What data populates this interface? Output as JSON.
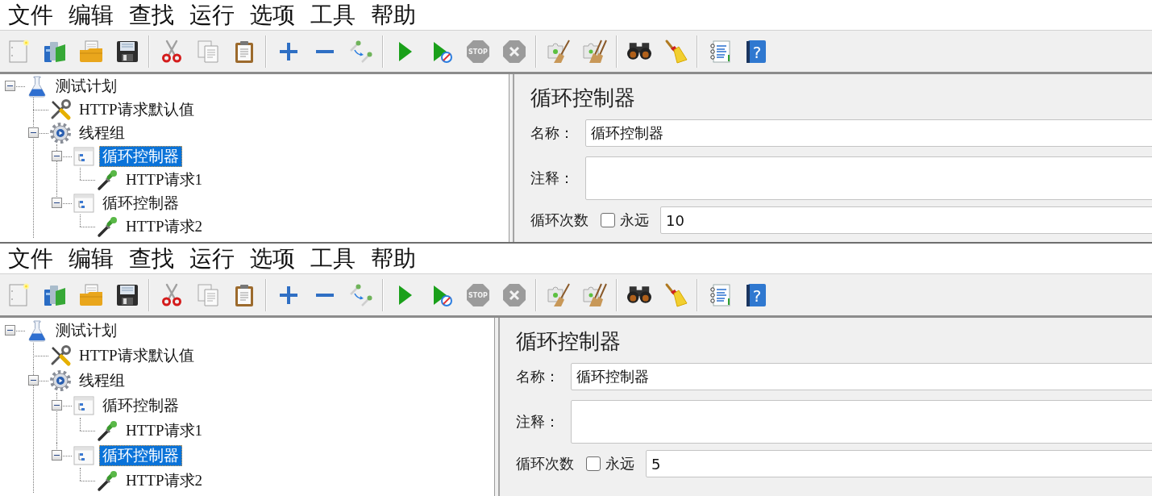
{
  "screenshots": [
    {
      "menu": [
        "文件",
        "编辑",
        "查找",
        "运行",
        "选项",
        "工具",
        "帮助"
      ],
      "toolbar": {
        "groups": [
          [
            {
              "kind": "new",
              "disabled": false
            },
            {
              "kind": "templates",
              "disabled": false
            },
            {
              "kind": "open",
              "disabled": false
            },
            {
              "kind": "save",
              "disabled": false
            }
          ],
          [
            {
              "kind": "cut",
              "disabled": false
            },
            {
              "kind": "copy",
              "disabled": false
            },
            {
              "kind": "paste",
              "disabled": false
            }
          ],
          [
            {
              "kind": "expand",
              "disabled": false
            },
            {
              "kind": "collapse",
              "disabled": false
            },
            {
              "kind": "toggle",
              "disabled": false
            }
          ],
          [
            {
              "kind": "start",
              "disabled": false
            },
            {
              "kind": "startnotimers",
              "disabled": false
            },
            {
              "kind": "stop",
              "text": "STOP",
              "disabled": true
            },
            {
              "kind": "shutdown",
              "disabled": true
            }
          ],
          [
            {
              "kind": "clear",
              "disabled": false
            },
            {
              "kind": "clearall",
              "disabled": false
            }
          ],
          [
            {
              "kind": "search",
              "disabled": false
            },
            {
              "kind": "reset",
              "disabled": false
            }
          ],
          [
            {
              "kind": "functions",
              "disabled": false
            },
            {
              "kind": "help",
              "text": "?",
              "disabled": false
            }
          ]
        ]
      },
      "tree": [
        {
          "label": "测试计划",
          "kind": "plan",
          "expanded": true,
          "selected": false,
          "children": [
            {
              "label": "HTTP请求默认值",
              "kind": "config",
              "selected": false
            },
            {
              "label": "线程组",
              "kind": "threadgroup",
              "expanded": true,
              "selected": false,
              "children": [
                {
                  "label": "循环控制器",
                  "kind": "controller",
                  "expanded": true,
                  "selected": true,
                  "children": [
                    {
                      "label": "HTTP请求1",
                      "kind": "sampler",
                      "selected": false
                    }
                  ]
                },
                {
                  "label": "循环控制器",
                  "kind": "controller",
                  "expanded": true,
                  "selected": false,
                  "children": [
                    {
                      "label": "HTTP请求2",
                      "kind": "sampler",
                      "selected": false
                    }
                  ]
                }
              ]
            }
          ]
        }
      ],
      "editor": {
        "title": "循环控制器",
        "name": {
          "label": "名称：",
          "value": "循环控制器"
        },
        "comment": {
          "label": "注释："
        },
        "loop_count": {
          "label": "循环次数",
          "forever": {
            "label": "永远",
            "checked": false
          },
          "value": "10"
        }
      }
    },
    {
      "menu": [
        "文件",
        "编辑",
        "查找",
        "运行",
        "选项",
        "工具",
        "帮助"
      ],
      "toolbar": {
        "groups": [
          [
            {
              "kind": "new",
              "disabled": false
            },
            {
              "kind": "templates",
              "disabled": false
            },
            {
              "kind": "open",
              "disabled": false
            },
            {
              "kind": "save",
              "disabled": false
            }
          ],
          [
            {
              "kind": "cut",
              "disabled": false
            },
            {
              "kind": "copy",
              "disabled": false
            },
            {
              "kind": "paste",
              "disabled": false
            }
          ],
          [
            {
              "kind": "expand",
              "disabled": false
            },
            {
              "kind": "collapse",
              "disabled": false
            },
            {
              "kind": "toggle",
              "disabled": false
            }
          ],
          [
            {
              "kind": "start",
              "disabled": false
            },
            {
              "kind": "startnotimers",
              "disabled": false
            },
            {
              "kind": "stop",
              "text": "STOP",
              "disabled": true
            },
            {
              "kind": "shutdown",
              "disabled": true
            }
          ],
          [
            {
              "kind": "clear",
              "disabled": false
            },
            {
              "kind": "clearall",
              "disabled": false
            }
          ],
          [
            {
              "kind": "search",
              "disabled": false
            },
            {
              "kind": "reset",
              "disabled": false
            }
          ],
          [
            {
              "kind": "functions",
              "disabled": false
            },
            {
              "kind": "help",
              "text": "?",
              "disabled": false
            }
          ]
        ]
      },
      "tree": [
        {
          "label": "测试计划",
          "kind": "plan",
          "expanded": true,
          "selected": false,
          "children": [
            {
              "label": "HTTP请求默认值",
              "kind": "config",
              "selected": false
            },
            {
              "label": "线程组",
              "kind": "threadgroup",
              "expanded": true,
              "selected": false,
              "children": [
                {
                  "label": "循环控制器",
                  "kind": "controller",
                  "expanded": true,
                  "selected": false,
                  "children": [
                    {
                      "label": "HTTP请求1",
                      "kind": "sampler",
                      "selected": false
                    }
                  ]
                },
                {
                  "label": "循环控制器",
                  "kind": "controller",
                  "expanded": true,
                  "selected": true,
                  "children": [
                    {
                      "label": "HTTP请求2",
                      "kind": "sampler",
                      "selected": false
                    }
                  ]
                }
              ]
            }
          ]
        }
      ],
      "editor": {
        "title": "循环控制器",
        "name": {
          "label": "名称：",
          "value": "循环控制器"
        },
        "comment": {
          "label": "注释："
        },
        "loop_count": {
          "label": "循环次数",
          "forever": {
            "label": "永远",
            "checked": false
          },
          "value": "5"
        }
      }
    }
  ]
}
